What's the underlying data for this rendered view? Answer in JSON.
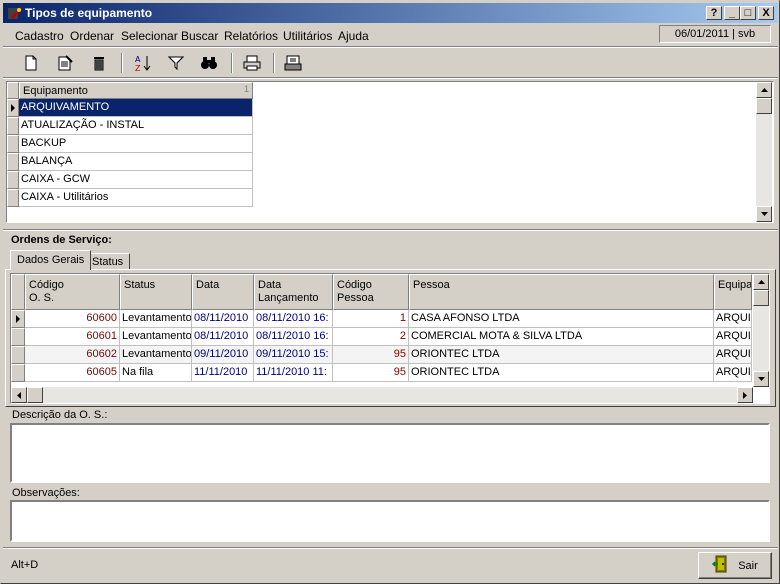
{
  "window": {
    "title": "Tipos de equipamento",
    "caption_buttons": [
      "?",
      "_",
      "□",
      "X"
    ],
    "date_user": "06/01/2011 | svb"
  },
  "menu": [
    "Cadastro",
    "Ordenar",
    "Selecionar",
    "Buscar",
    "Relatórios",
    "Utilitários",
    "Ajuda"
  ],
  "toolbar": [
    "new-icon",
    "edit-icon",
    "delete-icon",
    "sort-az-icon",
    "filter-icon",
    "binoculars-icon",
    "print-icon",
    "export-icon"
  ],
  "equipment_grid": {
    "header": "Equipamento",
    "sort_marker": "1",
    "rows": [
      "ARQUIVAMENTO",
      "ATUALIZAÇÃO - INSTAL",
      "BACKUP",
      "BALANÇA",
      "CAIXA - GCW",
      "CAIXA - Utilitários"
    ],
    "selected_index": 0
  },
  "orders": {
    "section_label": "Ordens de Serviço:",
    "tabs": [
      "Dados Gerais",
      "Status"
    ],
    "columns": [
      "Código\nO. S.",
      "Status",
      "Data",
      "Data\nLançamento",
      "Código\nPessoa",
      "Pessoa",
      "Equipam"
    ],
    "rows": [
      [
        "60600",
        "Levantamento",
        "08/11/2010",
        "08/11/2010 16:",
        "1",
        "CASA AFONSO LTDA",
        "ARQUIV"
      ],
      [
        "60601",
        "Levantamento",
        "08/11/2010",
        "08/11/2010 16:",
        "2",
        "COMERCIAL MOTA & SILVA LTDA",
        "ARQUIV"
      ],
      [
        "60602",
        "Levantamento",
        "09/11/2010",
        "09/11/2010 15:",
        "95",
        "ORIONTEC LTDA",
        "ARQUIV"
      ],
      [
        "60605",
        "Na fila",
        "11/11/2010",
        "11/11/2010 11:",
        "95",
        "ORIONTEC LTDA",
        "ARQUIV"
      ]
    ]
  },
  "descricao_label": "Descrição da O. S.:",
  "observacoes_label": "Observações:",
  "status_bar": "Alt+D",
  "exit_button": "Sair"
}
